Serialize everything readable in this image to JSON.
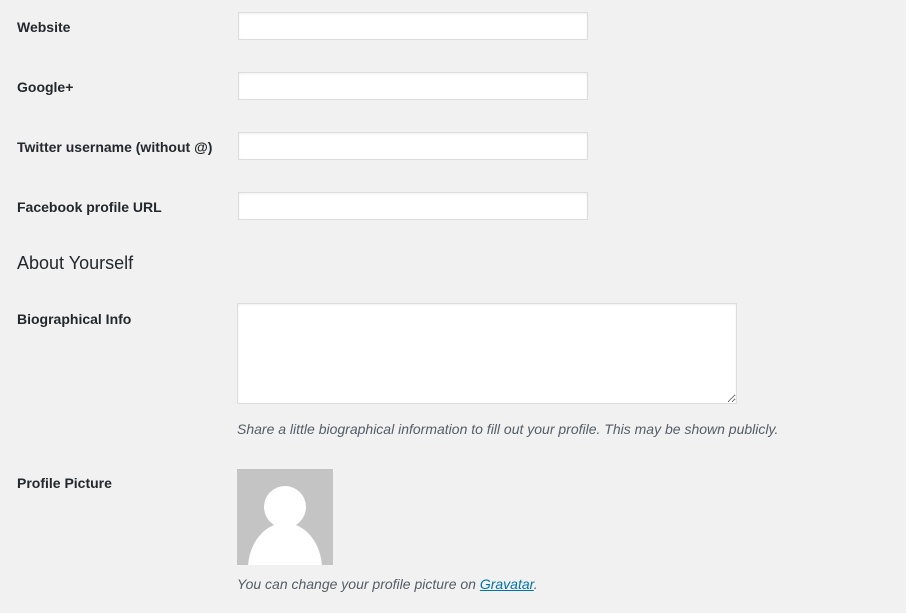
{
  "contact_info": {
    "website_label": "Website",
    "website_value": "",
    "googleplus_label": "Google+",
    "googleplus_value": "",
    "twitter_label": "Twitter username (without @)",
    "twitter_value": "",
    "facebook_label": "Facebook profile URL",
    "facebook_value": ""
  },
  "about": {
    "heading": "About Yourself",
    "bio_label": "Biographical Info",
    "bio_value": "",
    "bio_description": "Share a little biographical information to fill out your profile. This may be shown publicly.",
    "picture_label": "Profile Picture",
    "picture_icon": "default-avatar-silhouette",
    "picture_description_prefix": "You can change your profile picture on ",
    "gravatar_link": "Gravatar",
    "picture_description_suffix": "."
  },
  "colors": {
    "background": "#f1f1f1",
    "link": "#0073aa",
    "avatar_background": "#c4c4c4"
  }
}
